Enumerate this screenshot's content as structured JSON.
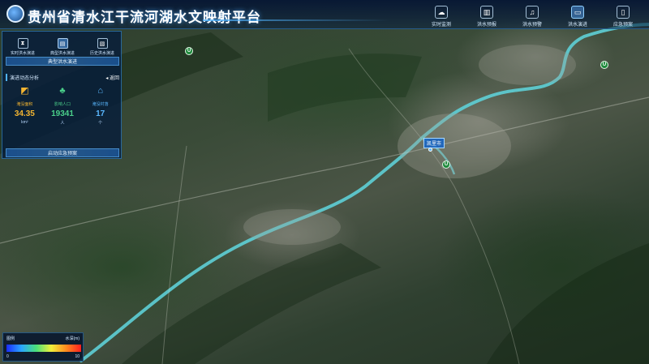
{
  "header": {
    "title": "贵州省清水江干流河湖水文映射平台",
    "nav": [
      {
        "label": "实时监测",
        "icon": "cloud-icon",
        "glyph": "☁"
      },
      {
        "label": "洪水预报",
        "icon": "book-icon",
        "glyph": "▥"
      },
      {
        "label": "洪水预警",
        "icon": "bell-icon",
        "glyph": "♫"
      },
      {
        "label": "洪水演进",
        "icon": "monitor-icon",
        "glyph": "▭"
      },
      {
        "label": "应急预案",
        "icon": "document-icon",
        "glyph": "▯"
      }
    ]
  },
  "panel": {
    "tabs": [
      {
        "label": "实时洪水演进",
        "icon": "hourglass-icon",
        "glyph": "⧗"
      },
      {
        "label": "典型洪水演进",
        "icon": "book-open-icon",
        "glyph": "▤"
      },
      {
        "label": "历史洪水演进",
        "icon": "files-icon",
        "glyph": "▧"
      }
    ],
    "section_title": "典型洪水演进",
    "analysis_title": "演进动态分析",
    "back_label": "◂ 返回",
    "stats": [
      {
        "label": "淹没面积",
        "value": "34.35",
        "unit": "km²",
        "icon": "area-icon",
        "glyph": "◩"
      },
      {
        "label": "影响人口",
        "value": "19341",
        "unit": "人",
        "icon": "people-icon",
        "glyph": "♣"
      },
      {
        "label": "淹没村落",
        "value": "17",
        "unit": "个",
        "icon": "house-icon",
        "glyph": "⌂"
      }
    ],
    "action_label": "启动应急预案"
  },
  "map": {
    "place_label": "凯里市",
    "marker_glyph": "U"
  },
  "legend": {
    "title": "图例",
    "unit": "水深(m)",
    "min": "0",
    "max": "10"
  }
}
